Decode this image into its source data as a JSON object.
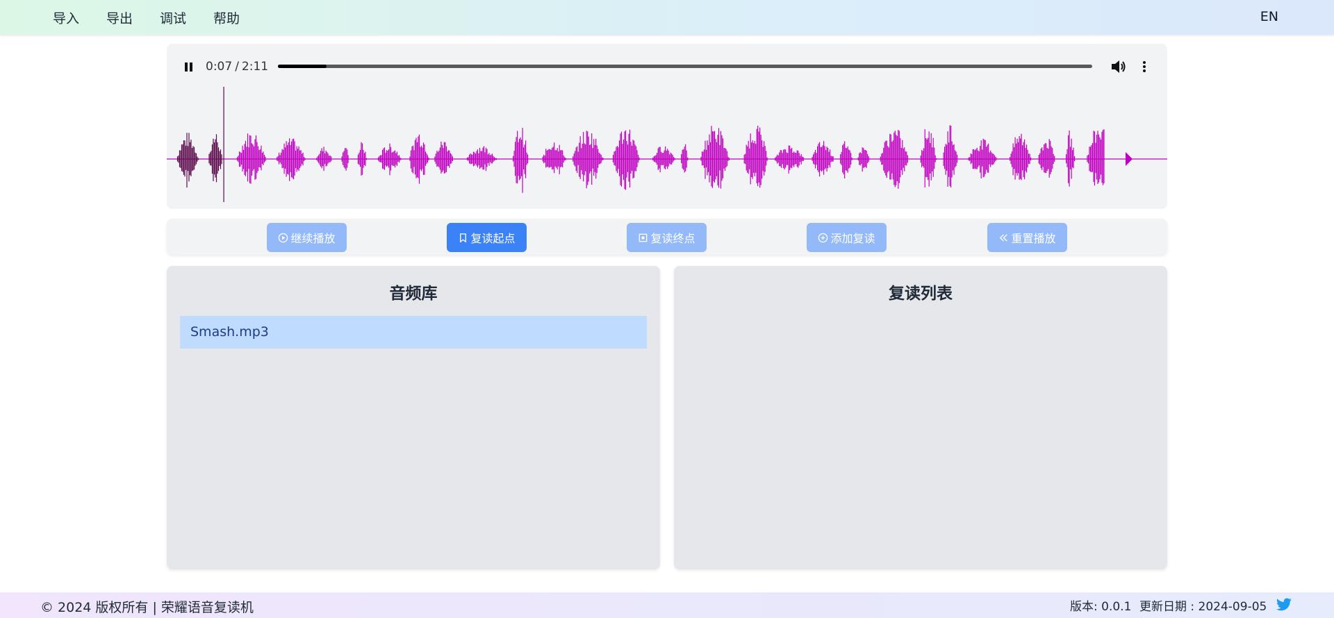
{
  "nav": {
    "items": [
      "导入",
      "导出",
      "调试",
      "帮助"
    ],
    "language": "EN"
  },
  "player": {
    "current_time": "0:07",
    "separator": "/",
    "duration": "2:11",
    "progress_fraction": 0.06,
    "playhead_fraction": 0.057,
    "waveform_color": "#c000c0",
    "waveform_played_color": "#5a0a4a"
  },
  "controls": [
    {
      "label": "继续播放",
      "icon": "play-circle-icon",
      "active": false
    },
    {
      "label": "复读起点",
      "icon": "bookmark-icon",
      "active": true
    },
    {
      "label": "复读终点",
      "icon": "square-stop-icon",
      "active": false
    },
    {
      "label": "添加复读",
      "icon": "plus-circle-icon",
      "active": false
    },
    {
      "label": "重置播放",
      "icon": "double-chevron-left-icon",
      "active": false
    }
  ],
  "library": {
    "title": "音频库",
    "items": [
      "Smash.mp3"
    ]
  },
  "repeat_list": {
    "title": "复读列表"
  },
  "footer": {
    "copyright": "© 2024 版权所有 | 荣耀语音复读机",
    "version": "版本: 0.0.1",
    "update_date": "更新日期 : 2024-09-05",
    "icon": "twitter-icon"
  },
  "colors": {
    "accent": "#3b82f6",
    "accent_disabled": "#93b9f8",
    "library_item_bg": "#bfdbfe"
  }
}
